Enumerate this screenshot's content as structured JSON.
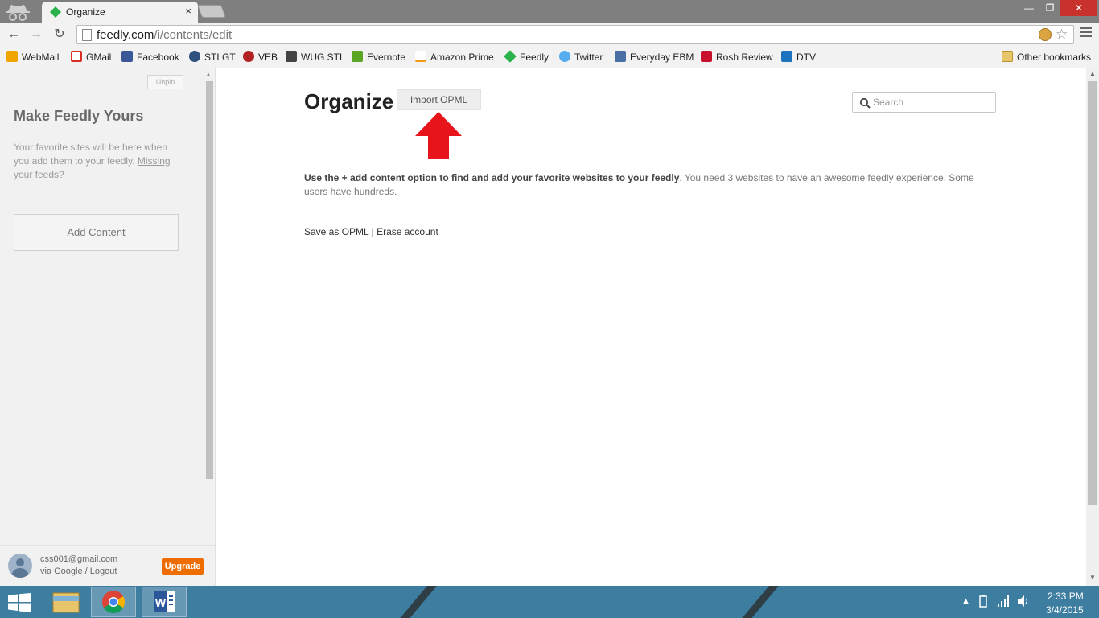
{
  "browser": {
    "tab_title": "Organize",
    "tab_close": "×",
    "window_controls": {
      "minimize": "—",
      "maximize": "❐",
      "close": "✕"
    },
    "url_host": "feedly.com",
    "url_path": "/i/contents/edit",
    "nav": {
      "back": "←",
      "forward": "→",
      "reload": "↻"
    },
    "star": "☆"
  },
  "bookmarks": [
    {
      "label": "WebMail",
      "icon": "webmail-icon",
      "color": "#f0a500"
    },
    {
      "label": "GMail",
      "icon": "gmail-icon",
      "color": "#d93025"
    },
    {
      "label": "Facebook",
      "icon": "facebook-icon",
      "color": "#3b5998"
    },
    {
      "label": "STLGT",
      "icon": "stlgt-icon",
      "color": "#2f4f7f"
    },
    {
      "label": "VEB",
      "icon": "veb-icon",
      "color": "#b22222"
    },
    {
      "label": "WUG STL",
      "icon": "wug-icon",
      "color": "#444444"
    },
    {
      "label": "Evernote",
      "icon": "evernote-icon",
      "color": "#5ba525"
    },
    {
      "label": "Amazon Prime",
      "icon": "amazon-icon",
      "color": "#222222"
    },
    {
      "label": "Feedly",
      "icon": "feedly-icon",
      "color": "#2bb24c"
    },
    {
      "label": "Twitter",
      "icon": "twitter-icon",
      "color": "#55acee"
    },
    {
      "label": "Everyday EBM",
      "icon": "ebm-icon",
      "color": "#4a6fa5"
    },
    {
      "label": "Rosh Review",
      "icon": "rosh-icon",
      "color": "#c8102e"
    },
    {
      "label": "DTV",
      "icon": "dtv-icon",
      "color": "#1e73be"
    }
  ],
  "other_bookmarks": "Other bookmarks",
  "sidebar": {
    "unpin_label": "Unpin",
    "title": "Make Feedly Yours",
    "desc_text": "Your favorite sites will be here when you add them to your feedly.",
    "desc_link": "Missing your feeds?",
    "add_content_label": "Add Content",
    "account_email": "css001@gmail.com",
    "account_via": "via Google / Logout",
    "upgrade_label": "Upgrade"
  },
  "main": {
    "title": "Organize",
    "import_label": "Import OPML",
    "search_placeholder": "Search",
    "message_bold": "Use the + add content option to find and add your favorite websites to your feedly",
    "message_rest": ". You need 3 websites to have an awesome feedly experience. Some users have hundreds.",
    "save_opml": "Save as OPML",
    "separator": "|",
    "erase_account": "Erase account"
  },
  "taskbar": {
    "time": "2:33 PM",
    "date": "3/4/2015"
  },
  "colors": {
    "accent_red": "#e8141c",
    "upgrade_orange": "#ef6c00",
    "taskbar_blue": "#3d7da0"
  }
}
